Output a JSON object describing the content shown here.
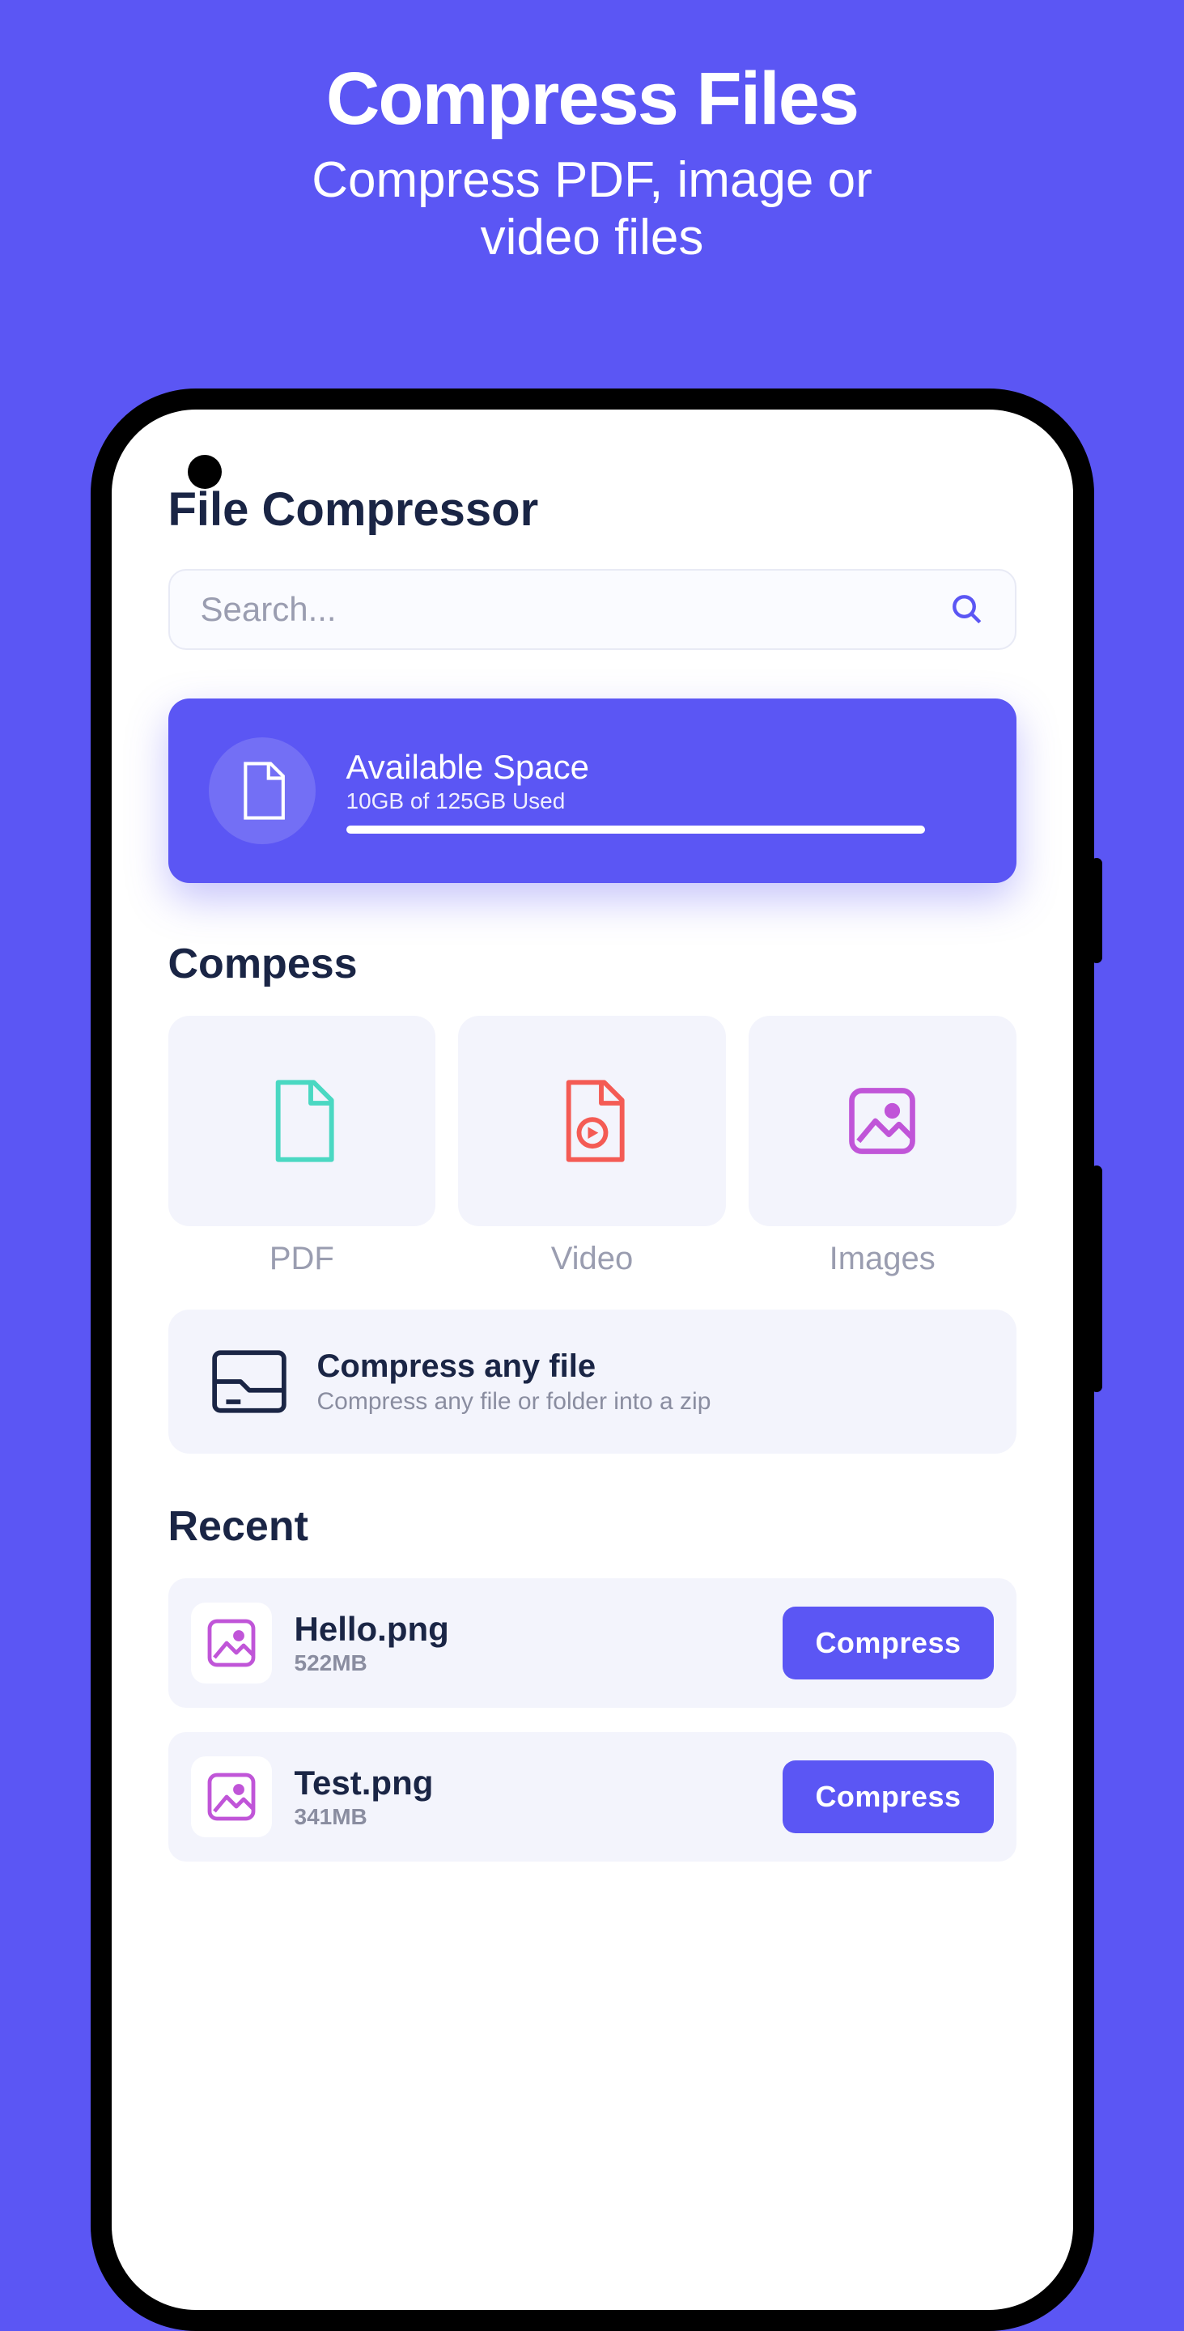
{
  "hero": {
    "title": "Compress Files",
    "subtitle_line1": "Compress PDF, image or",
    "subtitle_line2": "video files"
  },
  "app": {
    "title": "File Compressor",
    "search_placeholder": "Search..."
  },
  "storage": {
    "title": "Available Space",
    "subtitle": "10GB of 125GB Used"
  },
  "compress": {
    "section_title": "Compess",
    "items": [
      {
        "label": "PDF"
      },
      {
        "label": "Video"
      },
      {
        "label": "Images"
      }
    ],
    "zip_title": "Compress any file",
    "zip_subtitle": "Compress any file or folder into a zip"
  },
  "recent": {
    "section_title": "Recent",
    "items": [
      {
        "name": "Hello.png",
        "size": "522MB",
        "button": "Compress"
      },
      {
        "name": "Test.png",
        "size": "341MB",
        "button": "Compress"
      }
    ]
  }
}
